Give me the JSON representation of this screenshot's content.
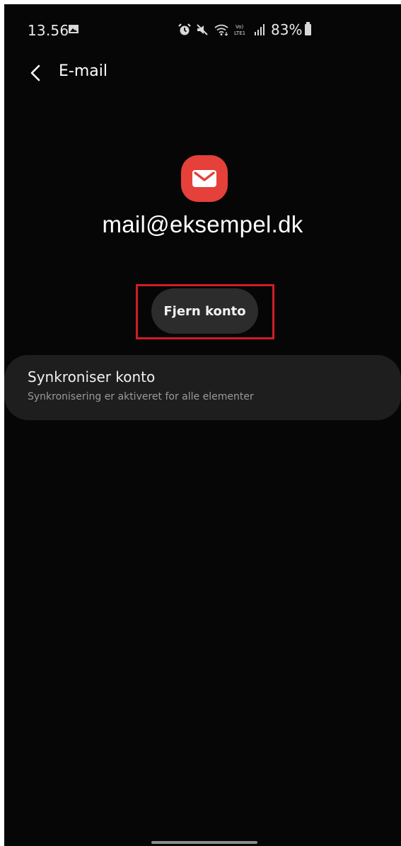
{
  "status_bar": {
    "time": "13.56",
    "battery_percent": "83%",
    "network_label": "Vo) LTE1",
    "icons": [
      "gallery-icon",
      "alarm-icon",
      "mute-icon",
      "wifi-icon",
      "signal-icon",
      "battery-icon"
    ]
  },
  "app_bar": {
    "title": "E-mail"
  },
  "account": {
    "email": "mail@eksempel.dk",
    "icon": "mail-envelope-icon",
    "icon_color": "#e5403a"
  },
  "actions": {
    "remove_label": "Fjern konto",
    "highlight_color": "#d11d24"
  },
  "sync": {
    "title": "Synkroniser konto",
    "subtitle": "Synkronisering er aktiveret for alle elementer"
  }
}
